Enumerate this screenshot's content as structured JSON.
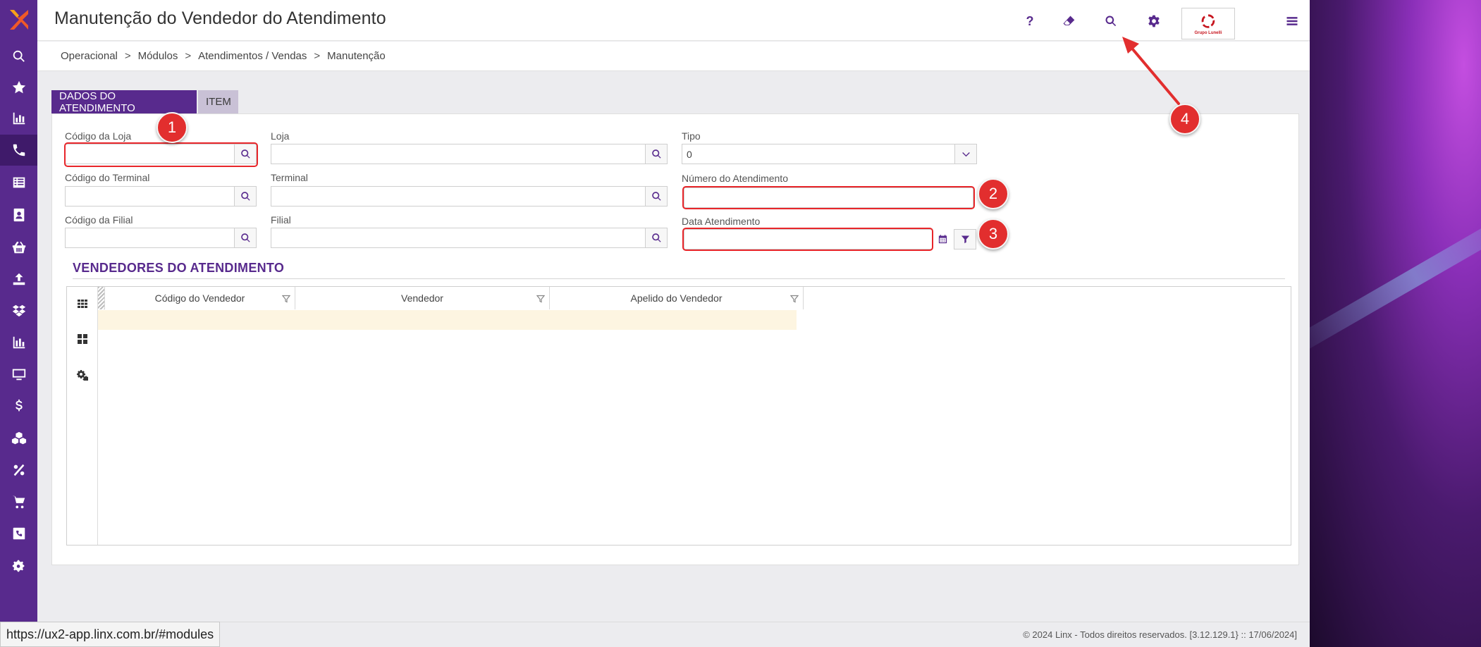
{
  "header": {
    "title": "Manutenção do Vendedor do Atendimento",
    "help_label": "?"
  },
  "breadcrumb": [
    "Operacional",
    "Módulos",
    "Atendimentos / Vendas",
    "Manutenção"
  ],
  "breadcrumb_separator": ">",
  "tabs": {
    "dados": "DADOS DO ATENDIMENTO",
    "item": "ITEM"
  },
  "company_logo_text": "Grupo Lunelli",
  "form": {
    "codigo_loja_label": "Código da Loja",
    "loja_label": "Loja",
    "tipo_label": "Tipo",
    "tipo_value": "0",
    "codigo_terminal_label": "Código do Terminal",
    "terminal_label": "Terminal",
    "numero_atendimento_label": "Número do Atendimento",
    "codigo_filial_label": "Código da Filial",
    "filial_label": "Filial",
    "data_atendimento_label": "Data Atendimento"
  },
  "section": {
    "title": "VENDEDORES DO ATENDIMENTO"
  },
  "grid": {
    "columns": [
      "Código do Vendedor",
      "Vendedor",
      "Apelido do Vendedor"
    ]
  },
  "annotations": [
    "1",
    "2",
    "3",
    "4"
  ],
  "status": {
    "url": "https://ux2-app.linx.com.br/#modules",
    "footer": "© 2024 Linx - Todos direitos reservados. [3.12.129.1} :: 17/06/2024]"
  },
  "colors": {
    "brand_purple": "#582a8d",
    "annotation_red": "#e22e2e",
    "row_highlight": "#fdf5e1"
  }
}
